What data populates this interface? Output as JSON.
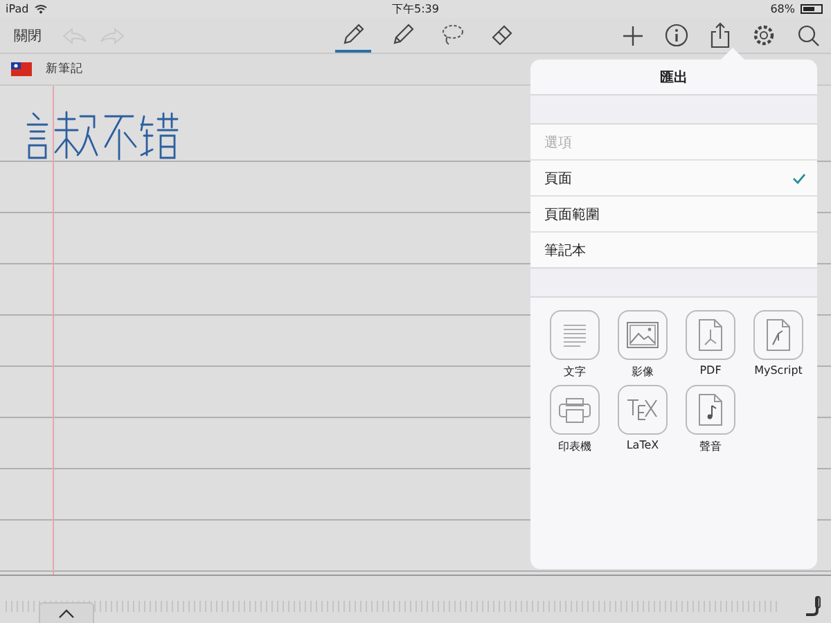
{
  "status_bar": {
    "device": "iPad",
    "time": "下午5:39",
    "battery": "68%"
  },
  "toolbar": {
    "close": "關閉",
    "tools": [
      {
        "kind": "pen",
        "selected": true
      },
      {
        "kind": "pencil",
        "selected": false
      },
      {
        "kind": "lasso",
        "selected": false
      },
      {
        "kind": "eraser",
        "selected": false
      }
    ]
  },
  "notebook": {
    "title": "新筆記"
  },
  "export_popover": {
    "title": "匯出",
    "options_header": "選項",
    "options": [
      {
        "label": "頁面",
        "selected": true
      },
      {
        "label": "頁面範圍",
        "selected": false
      },
      {
        "label": "筆記本",
        "selected": false
      }
    ],
    "formats": [
      {
        "kind": "text",
        "label": "文字"
      },
      {
        "kind": "image",
        "label": "影像"
      },
      {
        "kind": "pdf",
        "label": "PDF"
      },
      {
        "kind": "myscript",
        "label": "MyScript"
      },
      {
        "kind": "printer",
        "label": "印表機"
      },
      {
        "kind": "latex",
        "label": "LaTeX"
      },
      {
        "kind": "audio",
        "label": "聲音"
      }
    ]
  }
}
